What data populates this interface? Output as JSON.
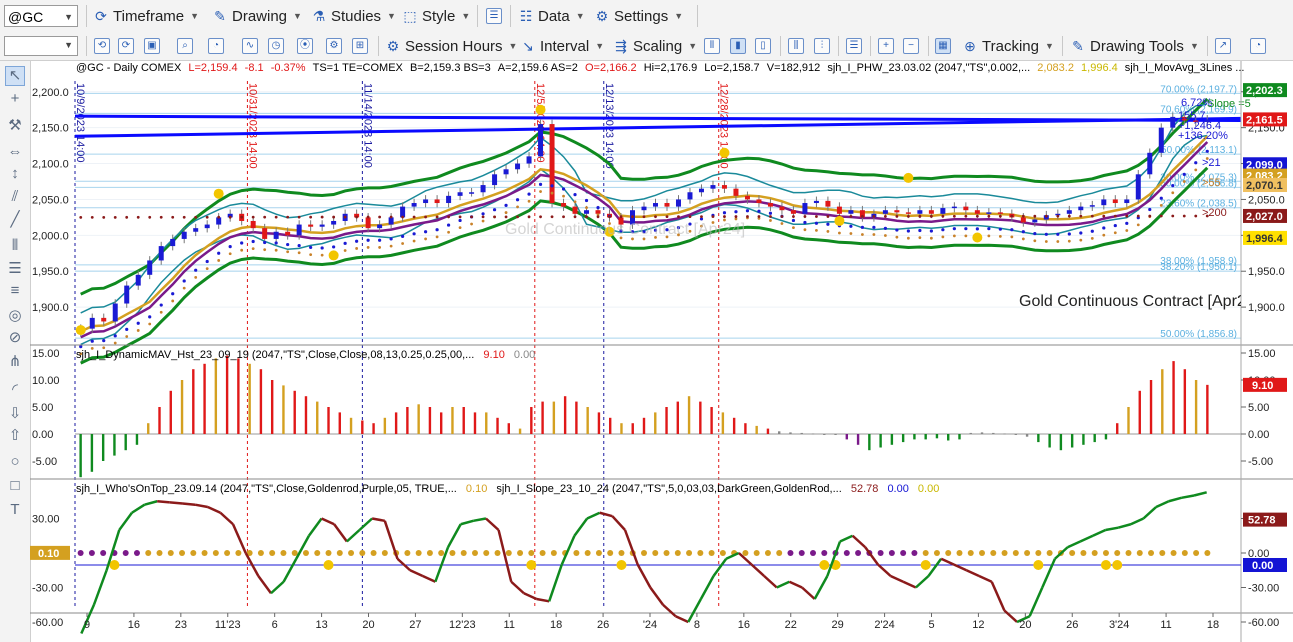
{
  "toolbar": {
    "symbol": "@GC",
    "menus": [
      {
        "label": "Timeframe",
        "icon": "timeframe-icon"
      },
      {
        "label": "Drawing",
        "icon": "drawing-icon"
      },
      {
        "label": "Studies",
        "icon": "studies-icon"
      },
      {
        "label": "Style",
        "icon": "style-icon"
      },
      {
        "label": "Data",
        "icon": "data-icon"
      },
      {
        "label": "Settings",
        "icon": "gear-icon"
      }
    ],
    "row2": [
      {
        "label": "Session Hours",
        "icon": "session-hours-icon"
      },
      {
        "label": "Interval",
        "icon": "interval-icon"
      },
      {
        "label": "Scaling",
        "icon": "scaling-icon"
      },
      {
        "label": "Tracking",
        "icon": "tracking-icon"
      },
      {
        "label": "Drawing Tools",
        "icon": "drawing-tools-icon"
      }
    ]
  },
  "left_tools": [
    "pointer-icon",
    "crosshair-icon",
    "wrench-icon",
    "horizontal-line-icon",
    "vertical-line-icon",
    "parallel-lines-icon",
    "trendline-icon",
    "bars-icon",
    "channel-icon",
    "layers-icon",
    "fibonacci-icon",
    "circle-tool-icon",
    "pitchfork-icon",
    "arc-icon",
    "arrow-down-icon",
    "arrow-up-icon",
    "ellipse-icon",
    "rectangle-icon",
    "text-tool-icon"
  ],
  "header": {
    "symbol": "@GC - Daily  COMEX",
    "last": "L=2,159.4",
    "chg": "-8.1",
    "pct": "-0.37%",
    "ts": "TS=1  TE=COMEX",
    "bid": "B=2,159.3  BS=3",
    "ask": "A=2,159.6  AS=2",
    "open": "O=2,166.2",
    "hi": "Hi=2,176.9",
    "lo": "Lo=2,158.7",
    "vol": "V=182,912",
    "study1": "sjh_I_PHW_23.03.02 (2047,\"TS\",0.002,...",
    "v1": "2,083.2",
    "v2": "1,996.4",
    "study2": "sjh_I_MovAvg_3Lines ..."
  },
  "panels": {
    "macd": {
      "title": "sjh_I_DynamicMAV_Hst_23_09_19 (2047,\"TS\",Close,Close,08,13,0.25,0.25,00,...",
      "v1": "9.10",
      "v2": "0.00"
    },
    "osc": {
      "title1": "sjh_I_Who'sOnTop_23.09.14 (2047,\"TS\",Close,Goldenrod,Purple,05,  TRUE,...",
      "v1": "0.10",
      "title2": "sjh_I_Slope_23_10_24 (2047,\"TS\",5,0,03,03,DarkGreen,GoldenRod,...",
      "v2": "52.78",
      "v3": "0.00",
      "v4": "0.00"
    }
  },
  "watermark": "Gold Continuous Contract [Apr24]",
  "contract_label": "Gold Continuous Contract [Apr2",
  "price_axis": {
    "ticks": [
      "2,200.0",
      "2,150.0",
      "2,100.0",
      "2,050.0",
      "2,000.0",
      "1,950.0",
      "1,900.0"
    ],
    "badges": [
      {
        "text": "2,202.3",
        "bg": "#0f8a1f",
        "fg": "#ffffff",
        "price": 2202.3
      },
      {
        "text": "2,161.5",
        "bg": "#e01818",
        "fg": "#ffffff",
        "price": 2161.5
      },
      {
        "text": "2,099.0",
        "bg": "#1414d4",
        "fg": "#ffffff",
        "price": 2099.0
      },
      {
        "text": "2,083.2",
        "bg": "#d4a020",
        "fg": "#ffffff",
        "price": 2083.2
      },
      {
        "text": "2,070.1",
        "bg": "#f0c060",
        "fg": "#333333",
        "price": 2070.1
      },
      {
        "text": "2,027.0",
        "bg": "#8b1a1a",
        "fg": "#ffffff",
        "price": 2027.0
      },
      {
        "text": "1,996.4",
        "bg": "#ffe000",
        "fg": "#333333",
        "price": 1996.4
      }
    ]
  },
  "fib_levels": [
    {
      "text": "70.00% (2,197.7)",
      "price": 2197.7
    },
    {
      "text": "70.60% (2,169.9)",
      "price": 2169.9
    },
    {
      "text": "50.00% (2,113.1)",
      "price": 2113.1
    },
    {
      "text": "30.00% (2,075.3)",
      "price": 2075.3
    },
    {
      "text": "50.00% (2,066.8)",
      "price": 2066.8
    },
    {
      "text": "23.60% (2,038.5)",
      "price": 2038.5
    },
    {
      "text": "38.00% (1,958.9)",
      "price": 1958.9
    },
    {
      "text": "38.20% (1,950.1)",
      "price": 1950.1
    },
    {
      "text": "50.00% (1,856.8)",
      "price": 1856.8
    }
  ],
  "right_labels": [
    "6.72%",
    "Slope =5",
    "155.7",
    "+1,246.4",
    "+136.20%",
    ">21",
    ">55",
    ">200"
  ],
  "vlines": [
    {
      "text": "10/9/2023 14:00",
      "color": "#1a1aa0",
      "dateIndex": 0
    },
    {
      "text": "10/31/2023 14:00",
      "color": "#e01818",
      "dateIndex": 15
    },
    {
      "text": "11/14/2023 14:00",
      "color": "#1a1aa0",
      "dateIndex": 25
    },
    {
      "text": "12/5/2023 14:00",
      "color": "#e01818",
      "dateIndex": 40
    },
    {
      "text": "12/13/2023 14:00",
      "color": "#1a1aa0",
      "dateIndex": 46
    },
    {
      "text": "12/28/2023 14:00",
      "color": "#e01818",
      "dateIndex": 56
    }
  ],
  "macd_axis": {
    "ticks": [
      "15.00",
      "10.00",
      "5.00",
      "0.00",
      "-5.00"
    ],
    "badge": "9.10"
  },
  "osc_axis": {
    "ticks": [
      "30.00",
      "0.00",
      "-30.00",
      "-60.00"
    ],
    "left_ticks": [
      "30.00",
      "0.10",
      "-30.00",
      "-60.00"
    ],
    "badge1": "52.78",
    "badge2": "0.00"
  },
  "x_axis": [
    "9",
    "16",
    "23",
    "11'23",
    "6",
    "13",
    "20",
    "27",
    "12'23",
    "11",
    "18",
    "26",
    "'24",
    "8",
    "16",
    "22",
    "29",
    "2'24",
    "5",
    "12",
    "20",
    "26",
    "3'24",
    "11",
    "18"
  ],
  "chart_data": {
    "type": "candlestick",
    "symbol": "@GC",
    "timeframe": "Daily",
    "ylim": [
      1850,
      2215
    ],
    "close": [
      1870,
      1885,
      1880,
      1905,
      1930,
      1945,
      1965,
      1985,
      1995,
      2005,
      2010,
      2015,
      2025,
      2030,
      2020,
      2010,
      1995,
      2005,
      2000,
      2015,
      2012,
      2015,
      2020,
      2030,
      2025,
      2010,
      2015,
      2025,
      2040,
      2045,
      2050,
      2045,
      2055,
      2060,
      2060,
      2070,
      2085,
      2092,
      2100,
      2110,
      2155,
      2045,
      2040,
      2030,
      2035,
      2030,
      2025,
      2015,
      2035,
      2040,
      2045,
      2040,
      2050,
      2060,
      2065,
      2070,
      2065,
      2055,
      2050,
      2045,
      2040,
      2035,
      2030,
      2045,
      2048,
      2040,
      2030,
      2035,
      2025,
      2030,
      2035,
      2032,
      2030,
      2035,
      2030,
      2038,
      2040,
      2035,
      2030,
      2032,
      2030,
      2025,
      2018,
      2022,
      2028,
      2030,
      2035,
      2040,
      2042,
      2050,
      2045,
      2050,
      2085,
      2115,
      2150,
      2165,
      2160,
      2158,
      2161.5
    ],
    "rsi_bars": [
      -8,
      -7,
      -5,
      -4,
      -3,
      -2,
      2,
      5,
      8,
      10,
      12,
      13,
      14,
      14.5,
      14,
      13,
      12,
      10,
      9,
      8,
      7,
      6,
      5,
      4,
      3,
      2.5,
      2,
      3,
      4,
      5,
      5.5,
      5,
      4,
      5,
      5,
      4,
      4,
      3,
      2,
      1,
      5,
      6,
      6,
      7,
      6,
      5,
      4,
      3,
      2,
      2,
      3,
      4,
      5,
      6,
      7,
      6,
      5,
      4,
      3,
      2,
      1.5,
      1,
      0.5,
      0.3,
      0.2,
      0.1,
      0,
      0,
      -1,
      -2,
      -3,
      -2.5,
      -2,
      -1.5,
      -1,
      -1,
      -0.8,
      -1.2,
      -1,
      0.2,
      0.3,
      0.2,
      0.1,
      0,
      -0.5,
      -1.5,
      -2.5,
      -3,
      -2.5,
      -2,
      -1.5,
      -1,
      2,
      5,
      8,
      10,
      12,
      13.5,
      12,
      10,
      9.1
    ],
    "slope": [
      -70,
      -45,
      -15,
      20,
      35,
      42,
      45,
      44,
      43,
      42,
      40,
      35,
      25,
      0,
      -20,
      -35,
      -25,
      -5,
      15,
      30,
      25,
      10,
      20,
      30,
      28,
      -5,
      -15,
      -20,
      -25,
      5,
      25,
      28,
      30,
      20,
      -25,
      -35,
      -40,
      -42,
      -10,
      15,
      30,
      35,
      32,
      20,
      -10,
      -30,
      -45,
      -55,
      -60,
      -40,
      -20,
      -5,
      0,
      -10,
      -20,
      -30,
      -25,
      -30,
      -40,
      -20,
      10,
      15,
      5,
      -10,
      -20,
      -25,
      -30,
      -20,
      -5,
      -10,
      -15,
      -20,
      -25,
      -50,
      -60,
      -55,
      -30,
      -5,
      5,
      10,
      15,
      20,
      22,
      25,
      30,
      40,
      45,
      48,
      50,
      52.78
    ]
  }
}
